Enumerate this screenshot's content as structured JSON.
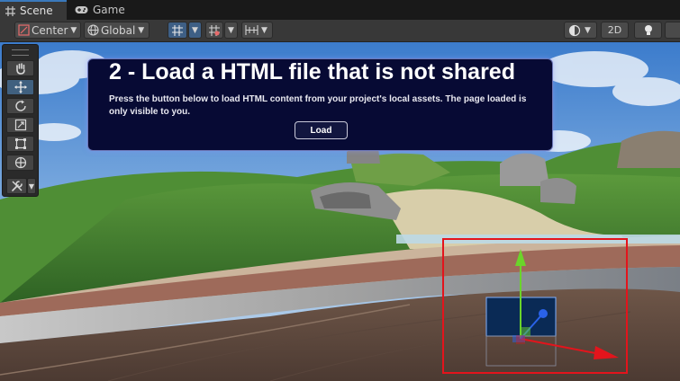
{
  "tabs": [
    {
      "label": "Scene",
      "icon": "grid-icon",
      "active": true
    },
    {
      "label": "Game",
      "icon": "gamepad-icon",
      "active": false
    }
  ],
  "toolbar": {
    "pivot_label": "Center",
    "space_label": "Global",
    "view_2d_label": "2D"
  },
  "panel": {
    "title": "2 - Load a HTML file that is not shared",
    "description": "Press the button below to load HTML content from your project's local assets. The page loaded is only visible to you.",
    "button_label": "Load"
  },
  "colors": {
    "selection_box": "#e3141c",
    "panel_bg": "#070a34",
    "gizmo_y": "#6bd42a",
    "gizmo_x": "#e3141c",
    "gizmo_z": "#2a62e8"
  }
}
